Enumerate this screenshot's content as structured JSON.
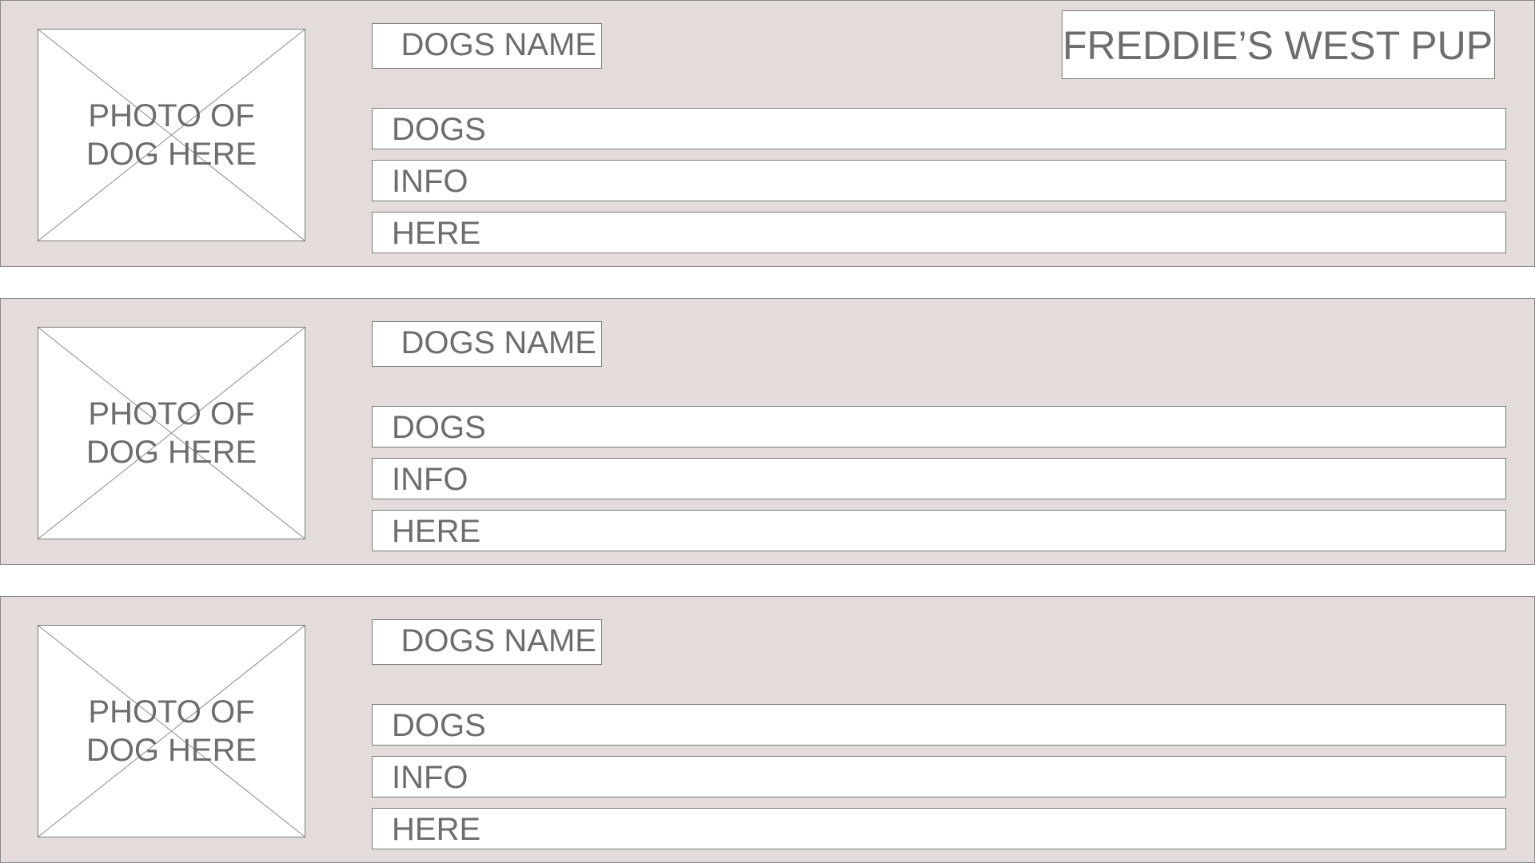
{
  "brand": {
    "title": "FREDDIE’S WEST PUPS"
  },
  "cards": [
    {
      "photo_line1": "PHOTO OF",
      "photo_line2": "DOG HERE",
      "name": "DOGS NAME",
      "info": [
        "DOGS",
        "INFO",
        "HERE"
      ]
    },
    {
      "photo_line1": "PHOTO OF",
      "photo_line2": "DOG HERE",
      "name": "DOGS NAME",
      "info": [
        "DOGS",
        "INFO",
        "HERE"
      ]
    },
    {
      "photo_line1": "PHOTO OF",
      "photo_line2": "DOG HERE",
      "name": "DOGS NAME",
      "info": [
        "DOGS",
        "INFO",
        "HERE"
      ]
    }
  ],
  "colors": {
    "card_background": "#e3dcdb",
    "text": "#6d6d6d",
    "border": "#7a7a7a"
  }
}
